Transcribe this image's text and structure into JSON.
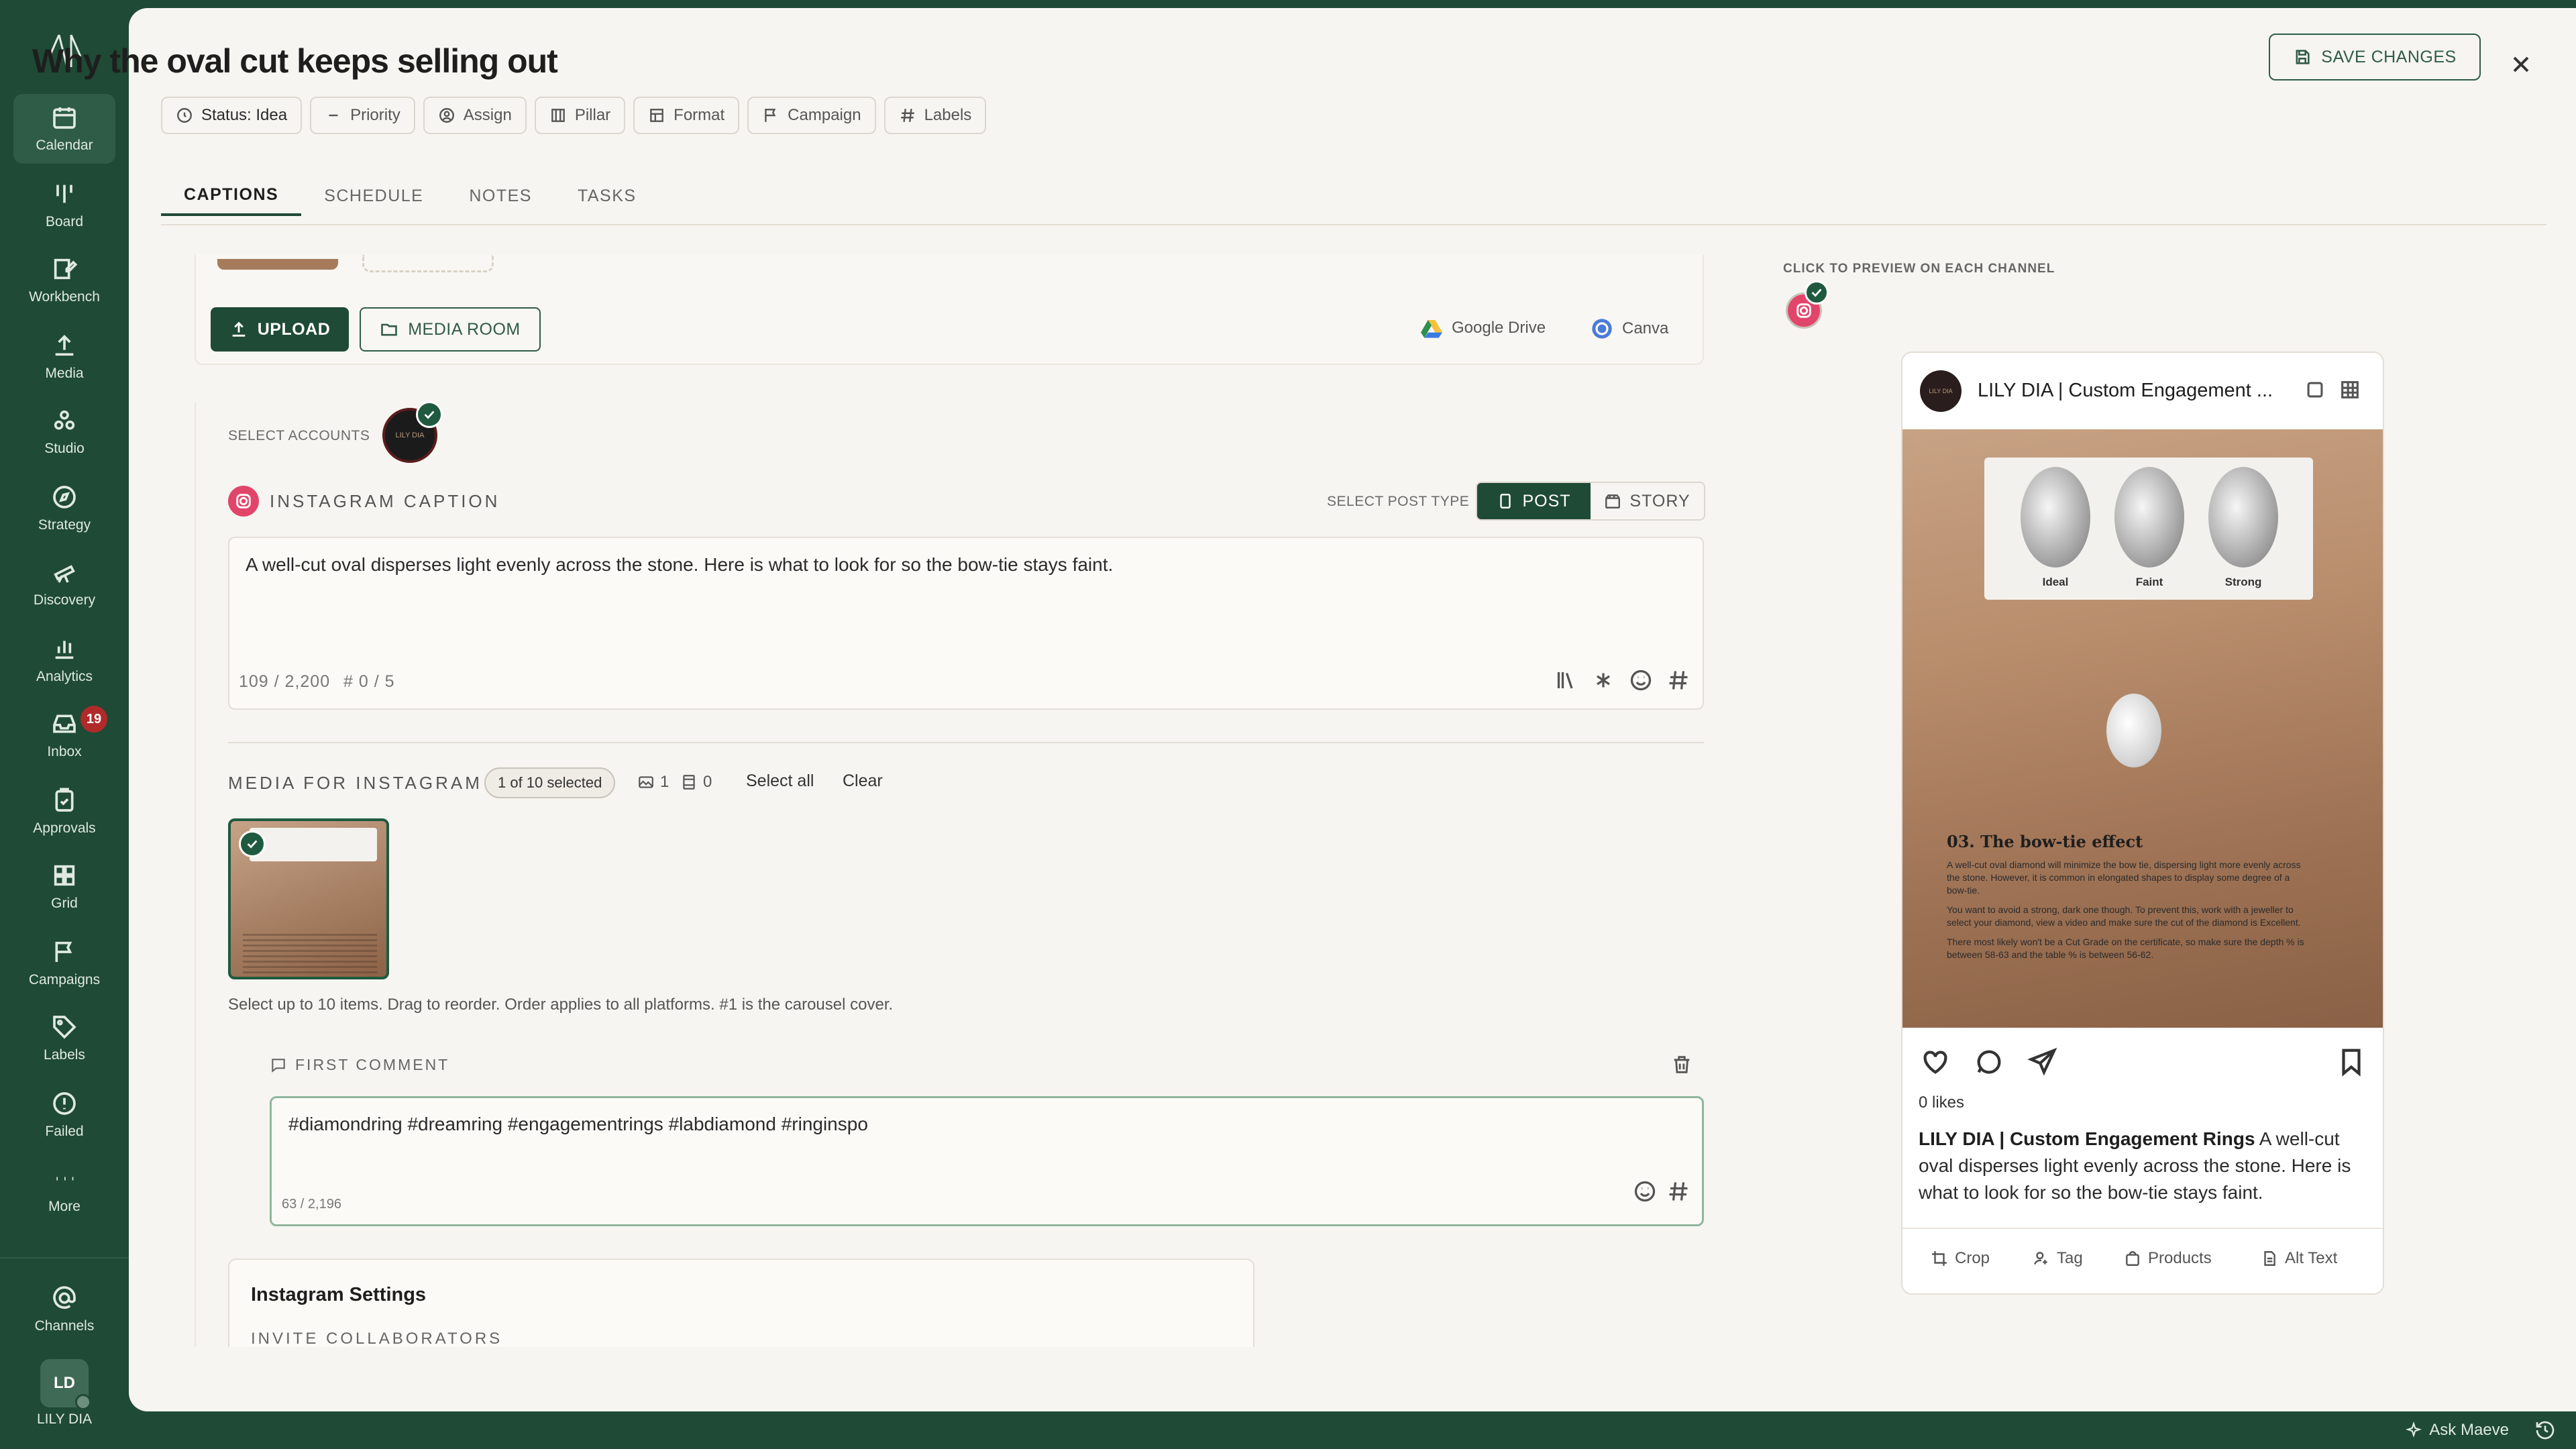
{
  "sidebar": {
    "items": [
      {
        "label": "Calendar",
        "icon": "calendar-icon",
        "active": true
      },
      {
        "label": "Board",
        "icon": "board-icon"
      },
      {
        "label": "Workbench",
        "icon": "workbench-icon"
      },
      {
        "label": "Media",
        "icon": "upload-icon"
      },
      {
        "label": "Studio",
        "icon": "studio-icon"
      },
      {
        "label": "Strategy",
        "icon": "compass-icon"
      },
      {
        "label": "Discovery",
        "icon": "telescope-icon"
      },
      {
        "label": "Analytics",
        "icon": "bar-chart-icon"
      },
      {
        "label": "Inbox",
        "icon": "inbox-icon",
        "badge": "19"
      },
      {
        "label": "Approvals",
        "icon": "clipboard-check-icon"
      },
      {
        "label": "Grid",
        "icon": "grid-icon"
      },
      {
        "label": "Campaigns",
        "icon": "flag-icon"
      },
      {
        "label": "Labels",
        "icon": "tag-icon"
      },
      {
        "label": "Failed",
        "icon": "alert-circle-icon"
      },
      {
        "label": "More",
        "icon": "more-dots-icon"
      }
    ],
    "channels_label": "Channels",
    "user_initials": "LD",
    "user_name": "LILY DIA"
  },
  "header": {
    "title": "Why the oval cut keeps selling out",
    "save_label": "SAVE CHANGES",
    "chips": {
      "status": "Status: Idea",
      "priority": "Priority",
      "assign": "Assign",
      "pillar": "Pillar",
      "format": "Format",
      "campaign": "Campaign",
      "labels": "Labels"
    }
  },
  "tabs": {
    "captions": "CAPTIONS",
    "schedule": "SCHEDULE",
    "notes": "NOTES",
    "tasks": "TASKS"
  },
  "upload": {
    "upload_label": "UPLOAD",
    "media_room_label": "MEDIA ROOM",
    "google_drive": "Google Drive",
    "canva": "Canva"
  },
  "accounts": {
    "label": "SELECT ACCOUNTS",
    "avatar_text": "LILY DIA"
  },
  "caption": {
    "heading": "INSTAGRAM CAPTION",
    "post_type_label": "SELECT POST TYPE",
    "post_label": "POST",
    "story_label": "STORY",
    "text": "A well-cut oval disperses light evenly across the stone. Here is what to look for so the bow-tie stays faint.",
    "char_count": "109 / 2,200",
    "hashtag_count": "# 0 / 5"
  },
  "media": {
    "heading": "MEDIA FOR INSTAGRAM",
    "selected": "1 of 10 selected",
    "image_count": "1",
    "video_count": "0",
    "select_all": "Select all",
    "clear": "Clear",
    "note": "Select up to 10 items. Drag to reorder. Order applies to all platforms. #1 is the carousel cover."
  },
  "first_comment": {
    "heading": "FIRST COMMENT",
    "text": "#diamondring #dreamring #engagementrings #labdiamond #ringinspo",
    "char_count": "63 / 2,196"
  },
  "settings": {
    "title": "Instagram Settings",
    "subtitle": "INVITE COLLABORATORS"
  },
  "preview": {
    "label": "CLICK TO PREVIEW ON EACH CHANNEL",
    "account_name": "LILY DIA | Custom Engagement ...",
    "diamond_labels": [
      "Ideal",
      "Faint",
      "Strong"
    ],
    "image_headline": "03. The bow-tie effect",
    "image_paragraphs": [
      "A well-cut oval diamond will minimize the bow tie, dispersing light more evenly across the stone. However, it is common in elongated shapes to display some degree of a bow-tie.",
      "You want to avoid a strong, dark one though. To prevent this, work with a jeweller to select your diamond, view a video and make sure the cut of the diamond is Excellent.",
      "There most likely won't be a Cut Grade on the certificate, so make sure the depth % is between 58-63 and the table % is between 56-62."
    ],
    "likes": "0 likes",
    "caption_account": "LILY DIA | Custom Engagement Rings",
    "caption_text": "A well-cut oval disperses light evenly across the stone. Here is what to look for so the bow-tie stays faint.",
    "tools": {
      "crop": "Crop",
      "tag": "Tag",
      "products": "Products",
      "alt_text": "Alt Text"
    }
  },
  "footer": {
    "ask_label": "Ask Maeve"
  },
  "colors": {
    "brand_green": "#1f4a35",
    "accent_pink": "#e2456a",
    "badge_red": "#b02a2a"
  }
}
